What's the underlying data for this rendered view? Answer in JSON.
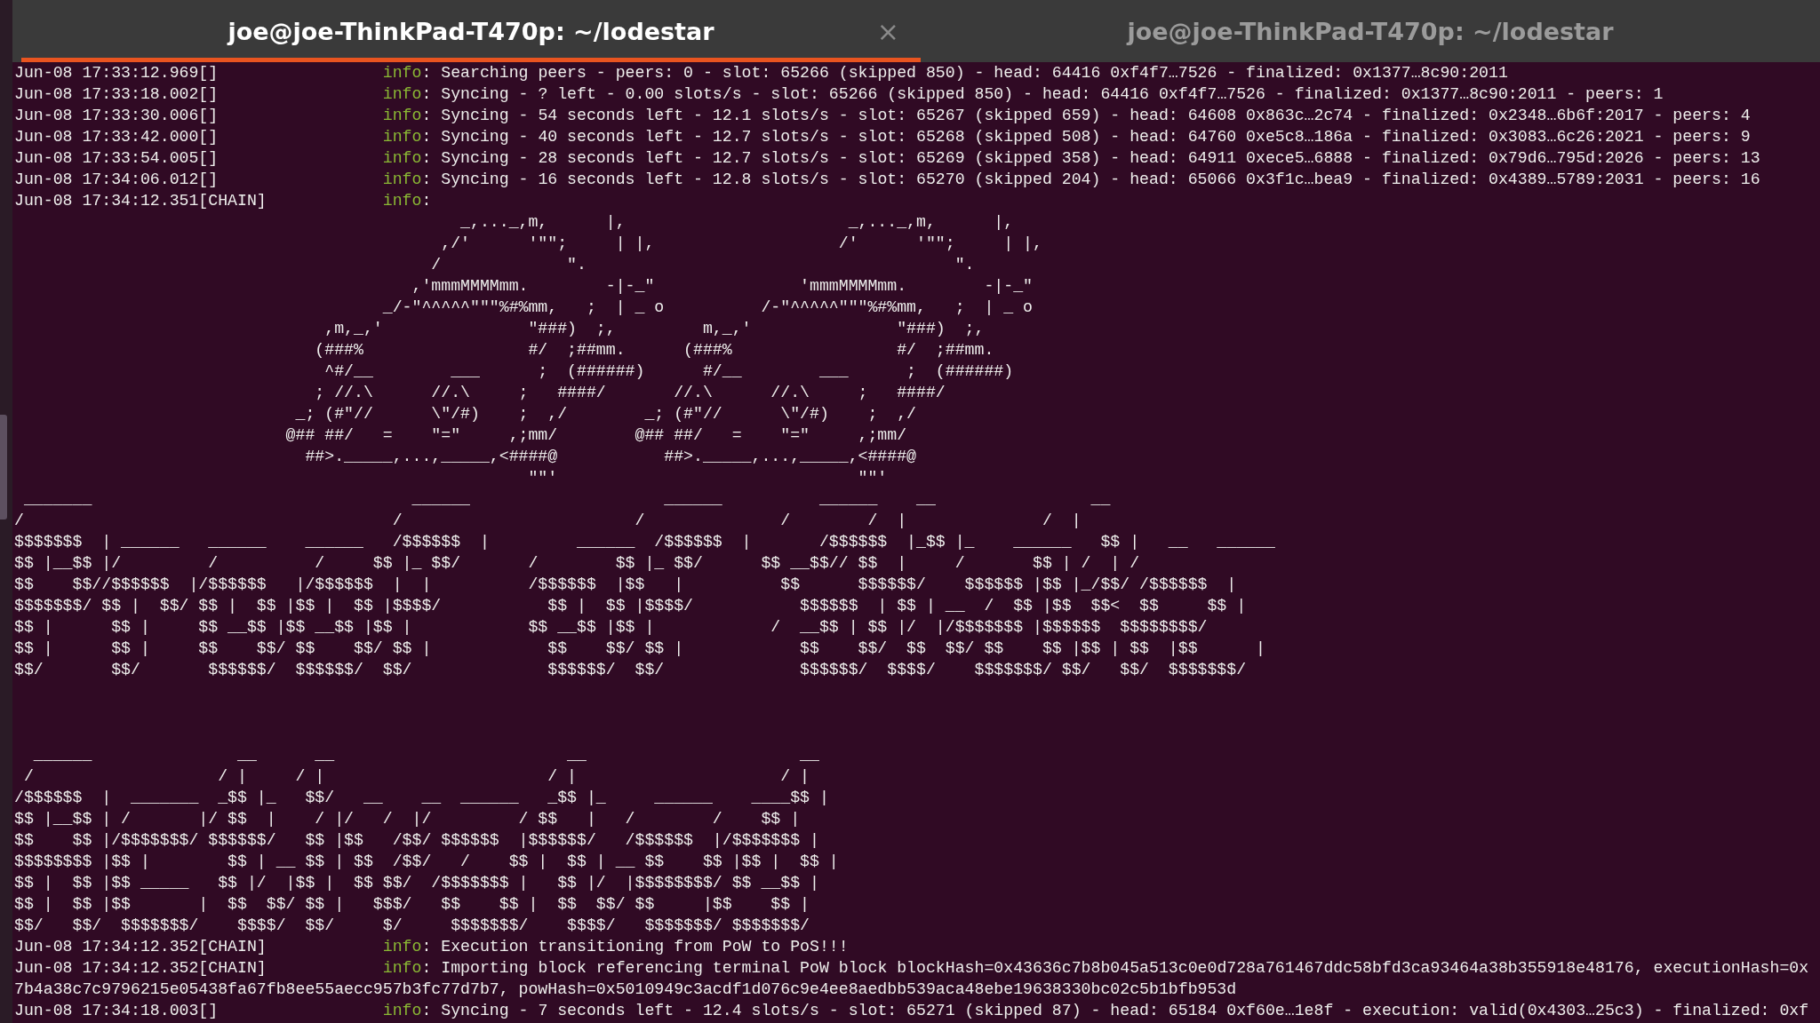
{
  "tabs": [
    {
      "title": "joe@joe-ThinkPad-T470p: ~/lodestar",
      "selected": true,
      "close": "×"
    },
    {
      "title": "joe@joe-ThinkPad-T470p: ~/lodestar",
      "selected": false
    }
  ],
  "lines": [
    {
      "kind": "log",
      "time": "Jun-08 17:33:12.969[]",
      "level": "info",
      "message": ": Searching peers - peers: 0 - slot: 65266 (skipped 850) - head: 64416 0xf4f7…7526 - finalized: 0x1377…8c90:2011"
    },
    {
      "kind": "log",
      "time": "Jun-08 17:33:18.002[]",
      "level": "info",
      "message": ": Syncing - ? left - 0.00 slots/s - slot: 65266 (skipped 850) - head: 64416 0xf4f7…7526 - finalized: 0x1377…8c90:2011 - peers: 1"
    },
    {
      "kind": "log",
      "time": "Jun-08 17:33:30.006[]",
      "level": "info",
      "message": ": Syncing - 54 seconds left - 12.1 slots/s - slot: 65267 (skipped 659) - head: 64608 0x863c…2c74 - finalized: 0x2348…6b6f:2017 - peers: 4"
    },
    {
      "kind": "log",
      "time": "Jun-08 17:33:42.000[]",
      "level": "info",
      "message": ": Syncing - 40 seconds left - 12.7 slots/s - slot: 65268 (skipped 508) - head: 64760 0xe5c8…186a - finalized: 0x3083…6c26:2021 - peers: 9"
    },
    {
      "kind": "log",
      "time": "Jun-08 17:33:54.005[]",
      "level": "info",
      "message": ": Syncing - 28 seconds left - 12.7 slots/s - slot: 65269 (skipped 358) - head: 64911 0xece5…6888 - finalized: 0x79d6…795d:2026 - peers: 13"
    },
    {
      "kind": "log",
      "time": "Jun-08 17:34:06.012[]",
      "level": "info",
      "message": ": Syncing - 16 seconds left - 12.8 slots/s - slot: 65270 (skipped 204) - head: 65066 0x3f1c…bea9 - finalized: 0x4389…5789:2031 - peers: 16"
    },
    {
      "kind": "log",
      "time": "Jun-08 17:34:12.351[CHAIN]",
      "level": "info",
      "message": ":"
    },
    {
      "kind": "art",
      "text": "                                              _,..._,m,      |,                       _,..._,m,      |,"
    },
    {
      "kind": "art",
      "text": "                                            ,/'      '\"\";     | |,                   /'      '\"\";     | |,"
    },
    {
      "kind": "art",
      "text": "                                           /             \".                                      \"."
    },
    {
      "kind": "art",
      "text": "                                         ,'mmmMMMMmm.        -|-_\"               'mmmMMMMmm.        -|-_\""
    },
    {
      "kind": "art",
      "text": "                                      _/-\"^^^^^\"\"\"%#%mm,   ;  | _ o          /-\"^^^^^\"\"\"%#%mm,   ;  | _ o"
    },
    {
      "kind": "art",
      "text": "                                ,m,_,'               \"###)  ;,         m,_,'               \"###)  ;,"
    },
    {
      "kind": "art",
      "text": "                               (###%                 #/  ;##mm.      (###%                 #/  ;##mm."
    },
    {
      "kind": "art",
      "text": "                                ^#/__        ___      ;  (######)      #/__        ___      ;  (######)"
    },
    {
      "kind": "art",
      "text": "                               ; //.\\      //.\\     ;   ####/       //.\\      //.\\     ;   ####/"
    },
    {
      "kind": "art",
      "text": "                             _; (#\"//      \\\"/#)    ;  ,/        _; (#\"//      \\\"/#)    ;  ,/"
    },
    {
      "kind": "art",
      "text": "                            @## ##/   =    \"=\"     ,;mm/        @## ##/   =    \"=\"     ,;mm/"
    },
    {
      "kind": "art",
      "text": "                              ##>._____,...,_____,<####@           ##>._____,...,_____,<####@"
    },
    {
      "kind": "art",
      "text": "                                                     \"\"'                               \"\"'"
    },
    {
      "kind": "art",
      "text": " _______                                 ______                    ______          ______    __                __"
    },
    {
      "kind": "art",
      "text": "/                                      /                        /              /        /  |              /  |"
    },
    {
      "kind": "art",
      "text": "$$$$$$$  | ______   ______    ______   /$$$$$$  |         ______  /$$$$$$  |       /$$$$$$  |_$$ |_    ______   $$ |   __   ______"
    },
    {
      "kind": "art",
      "text": "$$ |__$$ |/         /          /     $$ |_ $$/       /        $$ |_ $$/      $$ __$$// $$  |     /       $$ | /  | /"
    },
    {
      "kind": "art",
      "text": "$$    $$//$$$$$$  |/$$$$$$   |/$$$$$$  |  |          /$$$$$$  |$$   |          $$      $$$$$$/    $$$$$$ |$$ |_/$$/ /$$$$$$  |"
    },
    {
      "kind": "art",
      "text": "$$$$$$$/ $$ |  $$/ $$ |  $$ |$$ |  $$ |$$$$/           $$ |  $$ |$$$$/           $$$$$$  | $$ | __  /  $$ |$$  $$<  $$     $$ |"
    },
    {
      "kind": "art",
      "text": "$$ |      $$ |     $$ __$$ |$$ __$$ |$$ |            $$ __$$ |$$ |            /  __$$ | $$ |/  |/$$$$$$$ |$$$$$$  $$$$$$$$/"
    },
    {
      "kind": "art",
      "text": "$$ |      $$ |     $$    $$/ $$    $$/ $$ |            $$    $$/ $$ |            $$    $$/  $$  $$/ $$    $$ |$$ | $$  |$$      |"
    },
    {
      "kind": "art",
      "text": "$$/       $$/       $$$$$$/  $$$$$$/  $$/              $$$$$$/  $$/              $$$$$$/  $$$$/    $$$$$$$/ $$/   $$/  $$$$$$$/"
    },
    {
      "kind": "blank"
    },
    {
      "kind": "blank"
    },
    {
      "kind": "blank"
    },
    {
      "kind": "art",
      "text": "  ______               __      __                        __                      __"
    },
    {
      "kind": "art",
      "text": " /                   / |     / |                       / |                     / |"
    },
    {
      "kind": "art",
      "text": "/$$$$$$  |  _______  _$$ |_   $$/   __    __  ______   _$$ |_     ______    ____$$ |"
    },
    {
      "kind": "art",
      "text": "$$ |__$$ | /       |/ $$  |    / |/   /  |/         / $$   |   /        /    $$ |"
    },
    {
      "kind": "art",
      "text": "$$    $$ |/$$$$$$$/ $$$$$$/   $$ |$$   /$$/ $$$$$$  |$$$$$$/   /$$$$$$  |/$$$$$$$ |"
    },
    {
      "kind": "art",
      "text": "$$$$$$$$ |$$ |        $$ | __ $$ | $$  /$$/   /    $$ |  $$ | __ $$    $$ |$$ |  $$ |"
    },
    {
      "kind": "art",
      "text": "$$ |  $$ |$$ _____   $$ |/  |$$ |  $$ $$/  /$$$$$$$ |   $$ |/  |$$$$$$$$/ $$ __$$ |"
    },
    {
      "kind": "art",
      "text": "$$ |  $$ |$$       |  $$  $$/ $$ |   $$$/   $$    $$ |  $$  $$/ $$     |$$    $$ |"
    },
    {
      "kind": "art",
      "text": "$$/   $$/  $$$$$$$/    $$$$/  $$/     $/     $$$$$$$/    $$$$/   $$$$$$$/ $$$$$$$/"
    },
    {
      "kind": "log",
      "time": "Jun-08 17:34:12.352[CHAIN]",
      "level": "info",
      "message": ": Execution transitioning from PoW to PoS!!!"
    },
    {
      "kind": "log",
      "time": "Jun-08 17:34:12.352[CHAIN]",
      "level": "info",
      "message": ": Importing block referencing terminal PoW block blockHash=0x43636c7b8b045a513c0e0d728a761467ddc58bfd3ca93464a38b355918e48176, executionHash=0x"
    },
    {
      "kind": "text",
      "text": "7b4a38c7c9796215e05438fa67fb8ee55aecc957b3fc77d7b7, powHash=0x5010949c3acdf1d076c9e4ee8aedbb539aca48ebe19638330bc02c5b1bfb953d"
    },
    {
      "kind": "log",
      "time": "Jun-08 17:34:18.003[]",
      "level": "info",
      "message": ": Syncing - 7 seconds left - 12.4 slots/s - slot: 65271 (skipped 87) - head: 65184 0xf60e…1e8f - execution: valid(0x4303…25c3) - finalized: 0xf"
    }
  ]
}
